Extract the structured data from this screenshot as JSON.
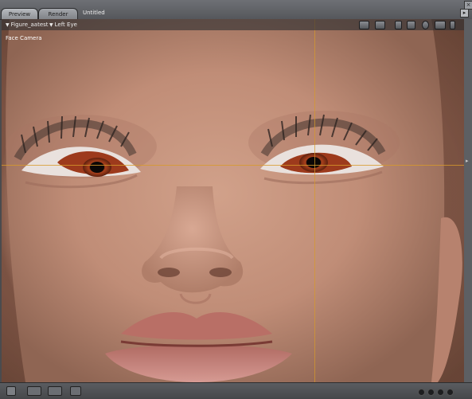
{
  "tabs": [
    {
      "label": "Preview",
      "active": true
    },
    {
      "label": "Render",
      "active": false
    }
  ],
  "document": {
    "title": "Untitled"
  },
  "viewport": {
    "figure_selector": "Figure_aatest",
    "part_selector": "Left Eye",
    "camera_label": "Face Camera"
  },
  "toolbar_icons": [
    "render-icon",
    "preview-icon",
    "shading-icon",
    "camera-icon",
    "light-icon",
    "sphere-icon",
    "move-icon",
    "target-icon",
    "phone-icon"
  ],
  "bottom_icons": [
    "document-icon",
    "figure-style-icon",
    "element-style-icon",
    "sphere-style-icon",
    "link-icon"
  ],
  "guide_color": "#d79a2a",
  "accent": "#f0f0f0"
}
